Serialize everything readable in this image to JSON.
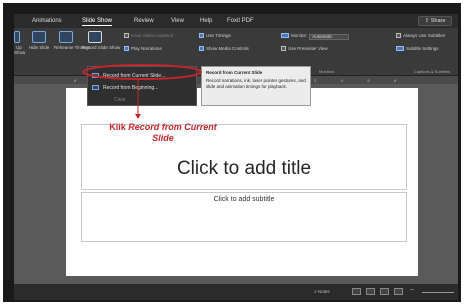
{
  "tabs": [
    {
      "label": "Animations"
    },
    {
      "label": "Slide Show",
      "active": true
    },
    {
      "label": "Review"
    },
    {
      "label": "View"
    },
    {
      "label": "Help"
    },
    {
      "label": "Foxit PDF"
    }
  ],
  "share_label": "Share",
  "ribbon": {
    "buttons": [
      {
        "label": "Up"
      },
      {
        "label": "Hide Slide"
      },
      {
        "label": "Rehearse Timings"
      },
      {
        "label": "Record Slide Show"
      }
    ],
    "left_cut_label": "Show",
    "checks": {
      "keep_updated": {
        "label": "Keep Slides Updated",
        "on": false
      },
      "use_timings": {
        "label": "Use Timings",
        "on": true
      },
      "play_narrations": {
        "label": "Play Narrations",
        "on": true
      },
      "show_media_controls": {
        "label": "Show Media Controls",
        "on": true
      },
      "presenter_view": {
        "label": "Use Presenter View",
        "on": false
      },
      "always_subtitles": {
        "label": "Always Use Subtitles",
        "on": false
      }
    },
    "monitor": {
      "label": "Monitor:",
      "value": "Automatic"
    },
    "subtitle_settings_label": "Subtitle Settings",
    "group_monitors": "Monitors",
    "group_captions": "Captions & Subtitles"
  },
  "dropdown": {
    "items": [
      {
        "label": "Record from Current Slide..."
      },
      {
        "label": "Record from Beginning..."
      },
      {
        "label": "Clear"
      }
    ]
  },
  "tooltip": {
    "title": "Record from Current Slide",
    "body": "Record narrations, ink, laser pointer gestures, and slide and animation timings for playback."
  },
  "annotation": {
    "prefix": "Klik ",
    "emph_1": "Record from Current",
    "emph_2": "Slide"
  },
  "slide": {
    "title_placeholder": "Click to add title",
    "subtitle_placeholder": "Click to add subtitle"
  },
  "ruler_ticks": [
    "6",
    "5",
    "4",
    "3",
    "2",
    "1",
    "0",
    "1",
    "2",
    "3",
    "4",
    "5",
    "6"
  ],
  "status": {
    "notes_label": "Notes"
  },
  "colors": {
    "annotation": "#c0262b",
    "accent": "#4a78b8"
  }
}
